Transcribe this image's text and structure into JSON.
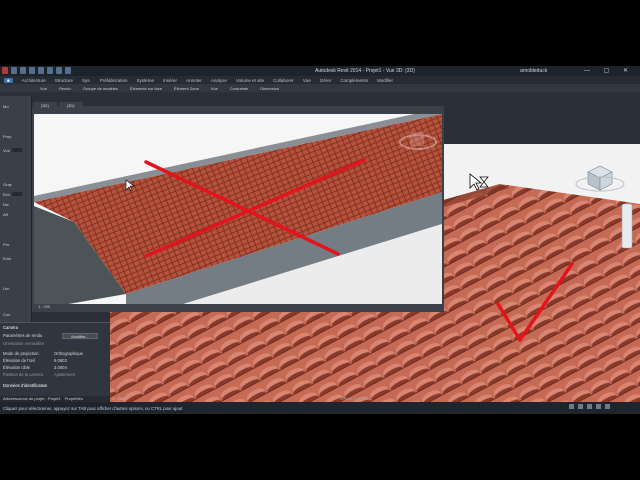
{
  "window": {
    "title": "Autodesk Revit 2014 - Projet1 - Vue 3D: {3D}",
    "user": "arnoldeduck",
    "controls": "— ▢ ✕"
  },
  "ribbon_tabs": [
    "Architecture",
    "Structure",
    "Sys.",
    "Préfabrication",
    "Système",
    "Insérer",
    "Annoter",
    "Analyse",
    "Volume et site",
    "Collaborer",
    "Vue",
    "Gérer",
    "Compléments",
    "Modifier"
  ],
  "ribbon_tools": [
    "Vue",
    "Rendu",
    "Groupe de modèles",
    "Éléments sur face",
    "Élément Zone",
    "Vue",
    "Contrainte",
    "Dimension"
  ],
  "view_tabs": [
    "{3D}",
    "{3D}"
  ],
  "left_panel_rows": [
    "Mo",
    "Prop",
    "Vue",
    "Grap",
    "Ech",
    "Niv",
    "Aff",
    "Pro",
    "Eme",
    "Lim",
    "Con",
    "Zon"
  ],
  "properties": {
    "header": "Caméra",
    "rows": [
      {
        "label": "Paramètres de rendu",
        "value": "Modifier..."
      },
      {
        "label": "Orientation verrouillée",
        "value": ""
      },
      {
        "label": "Mode de projection",
        "value": "Orthographique"
      },
      {
        "label": "Élévation de l'œil",
        "value": "6.0603"
      },
      {
        "label": "Élévation cible",
        "value": "3.0004"
      },
      {
        "label": "Position de la caméra",
        "value": "Ajustement"
      },
      {
        "label": "Données d'identification",
        "value": ""
      }
    ],
    "help_link": "Aide sur les propriétés",
    "apply": "Appliquer"
  },
  "browser_tabs": [
    "Arborescence du projet - Projet1",
    "Propriétés"
  ],
  "status": {
    "message": "Cliquez pour sélectionner, appuyez sur TAB pour afficher d'autres options, ou CTRL pour ajout",
    "scale_main": "1 : 200",
    "scale_inset": "1 : 200",
    "model": "Modèle de base",
    "zoom": "0"
  },
  "colors": {
    "tile": "#b5523a",
    "tile_dark": "#7a2a1c",
    "cross": "#e4141c",
    "panel": "#30363f"
  },
  "annotations": {
    "wrong": "cross mark over inset view",
    "right": "check mark over main view"
  }
}
